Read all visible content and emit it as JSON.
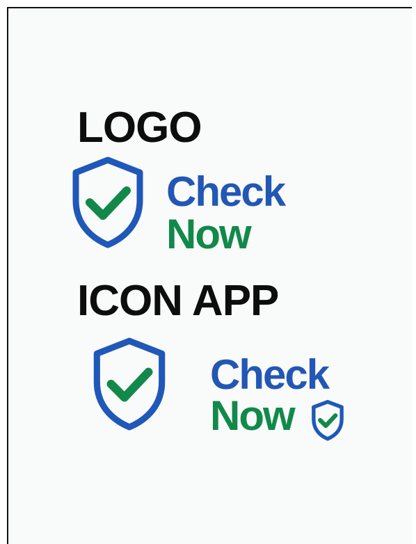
{
  "logo_section": {
    "heading": "LOGO",
    "wordmark_line1": "Check",
    "wordmark_line2": "Now",
    "shield_icon": "shield-check-icon"
  },
  "icon_app_section": {
    "heading": "ICON APP",
    "wordmark_line1": "Check",
    "wordmark_line2": "Now",
    "app_icon": "shield-check-icon",
    "inline_icon": "small-shield-check-icon"
  },
  "colors": {
    "shield_blue": "#1f58b8",
    "wordmark_blue": "#2257b4",
    "check_green": "#12894a",
    "heading_black": "#0d0d0d"
  }
}
